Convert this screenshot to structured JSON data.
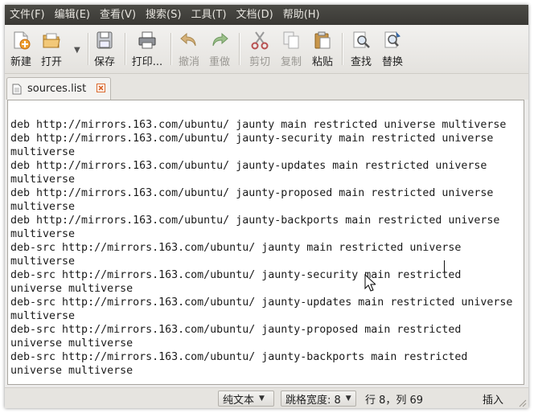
{
  "menubar": {
    "items": [
      "文件(F)",
      "编辑(E)",
      "查看(V)",
      "搜索(S)",
      "工具(T)",
      "文档(D)",
      "帮助(H)"
    ]
  },
  "toolbar": {
    "new": "新建",
    "open": "打开",
    "save": "保存",
    "print": "打印...",
    "undo": "撤消",
    "redo": "重做",
    "cut": "剪切",
    "copy": "复制",
    "paste": "粘贴",
    "find": "查找",
    "replace": "替换"
  },
  "tabs": [
    {
      "label": "sources.list"
    }
  ],
  "editor": {
    "lines": [
      "deb http://mirrors.163.com/ubuntu/ jaunty main restricted universe multiverse",
      "deb http://mirrors.163.com/ubuntu/ jaunty-security main restricted universe",
      "multiverse",
      "deb http://mirrors.163.com/ubuntu/ jaunty-updates main restricted universe",
      "multiverse",
      "deb http://mirrors.163.com/ubuntu/ jaunty-proposed main restricted universe",
      "multiverse",
      "deb http://mirrors.163.com/ubuntu/ jaunty-backports main restricted universe",
      "multiverse",
      "deb-src http://mirrors.163.com/ubuntu/ jaunty main restricted universe",
      "multiverse",
      "deb-src http://mirrors.163.com/ubuntu/ jaunty-security main restricted",
      "universe multiverse",
      "deb-src http://mirrors.163.com/ubuntu/ jaunty-updates main restricted universe",
      "multiverse",
      "deb-src http://mirrors.163.com/ubuntu/ jaunty-proposed main restricted",
      "universe multiverse",
      "deb-src http://mirrors.163.com/ubuntu/ jaunty-backports main restricted",
      "universe multiverse"
    ]
  },
  "statusbar": {
    "language": "纯文本",
    "tab_width": "跳格宽度: 8",
    "position": "行 8，列 69",
    "mode": "插入"
  }
}
